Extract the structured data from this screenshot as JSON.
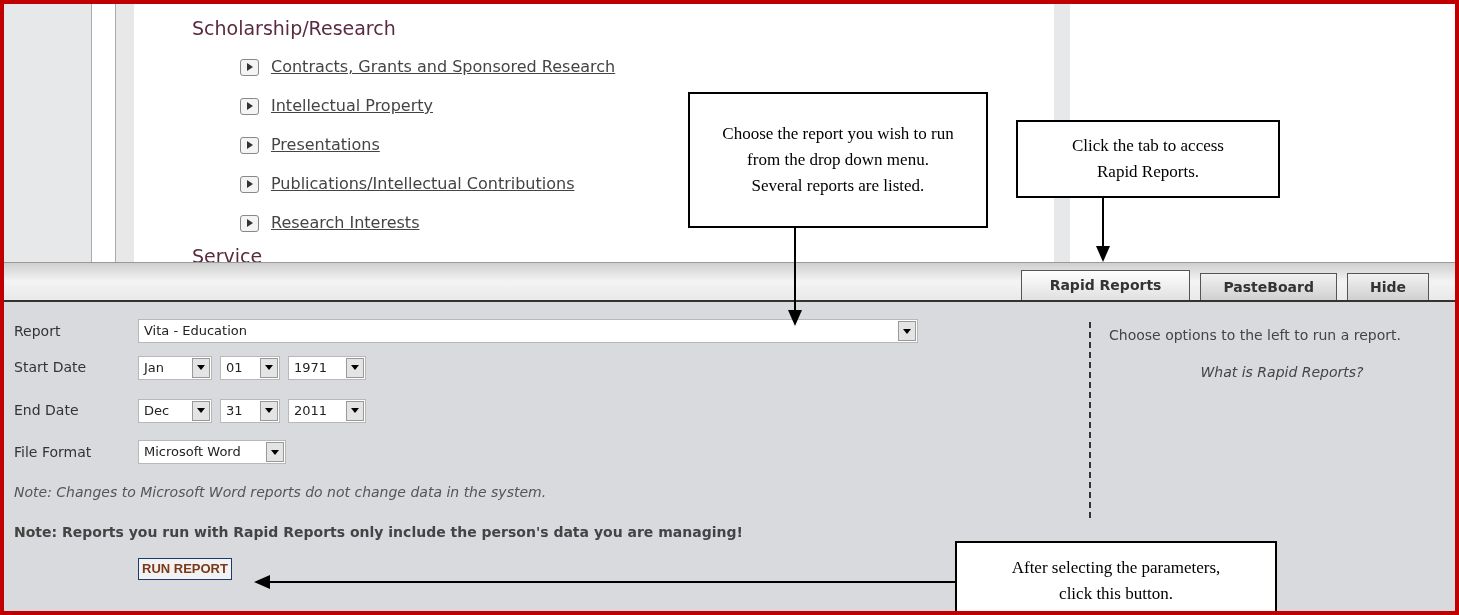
{
  "outline": {
    "heading": "Scholarship/Research",
    "items": [
      {
        "label": "Contracts, Grants and Sponsored Research"
      },
      {
        "label": "Intellectual Property"
      },
      {
        "label": "Presentations"
      },
      {
        "label": "Publications/Intellectual Contributions"
      },
      {
        "label": "Research Interests"
      }
    ],
    "next_heading": "Service"
  },
  "tabs": [
    {
      "label": "Rapid Reports",
      "selected": true
    },
    {
      "label": "PasteBoard",
      "selected": false
    },
    {
      "label": "Hide",
      "selected": false
    }
  ],
  "form": {
    "report": {
      "label": "Report",
      "value": "Vita - Education"
    },
    "start_date": {
      "label": "Start Date",
      "month": "Jan",
      "day": "01",
      "year": "1971"
    },
    "end_date": {
      "label": "End Date",
      "month": "Dec",
      "day": "31",
      "year": "2011"
    },
    "file_format": {
      "label": "File Format",
      "value": "Microsoft Word"
    },
    "note_1": "Note: Changes to Microsoft Word reports do not change data in the system.",
    "note_2": "Note: Reports you run with Rapid Reports only include the person's data you are managing!",
    "run_button": "RUN REPORT"
  },
  "side_panel": {
    "hint": "Choose options to the left to run a report.",
    "link": "What is Rapid Reports?"
  },
  "callouts": [
    {
      "text": "Choose the report you wish to run from the drop down menu.  Several reports are listed."
    },
    {
      "text": "Click the tab to access Rapid Reports."
    },
    {
      "text": "After selecting the parameters, click this button."
    }
  ]
}
